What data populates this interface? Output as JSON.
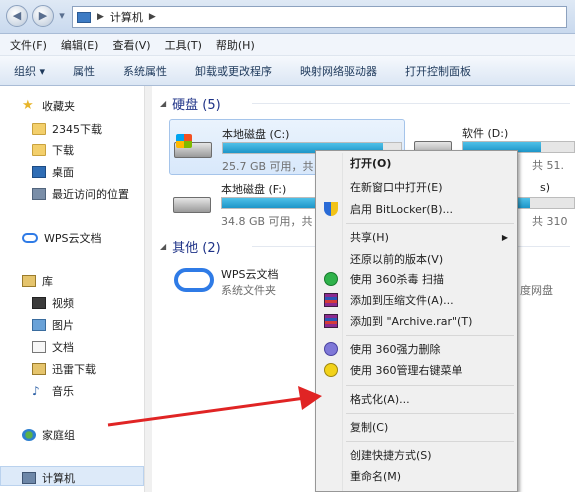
{
  "address": {
    "segments": [
      "计算机"
    ]
  },
  "menubar": [
    "文件(F)",
    "编辑(E)",
    "查看(V)",
    "工具(T)",
    "帮助(H)"
  ],
  "toolbar": [
    "组织 ▾",
    "属性",
    "系统属性",
    "卸载或更改程序",
    "映射网络驱动器",
    "打开控制面板"
  ],
  "nav": {
    "favorites": "收藏夹",
    "fav_items": [
      "2345下载",
      "下载",
      "桌面",
      "最近访问的位置"
    ],
    "wps": "WPS云文档",
    "library": "库",
    "lib_items": [
      "视频",
      "图片",
      "文档",
      "迅雷下载",
      "音乐"
    ],
    "homegroup": "家庭组",
    "computer": "计算机"
  },
  "content": {
    "hdd_group": "硬盘 (5)",
    "other_group": "其他 (2)",
    "drives": [
      {
        "name": "本地磁盘 (C:)",
        "info": "25.7 GB 可用，共",
        "used": 0.9
      },
      {
        "name": "本地磁盘 (F:)",
        "info": "34.8 GB 可用，共",
        "used": 0.8
      },
      {
        "name": "软件 (D:)",
        "info": "共 51.",
        "used": 0.7
      },
      {
        "name": "s)",
        "info": "共 310",
        "used": 0.6
      }
    ],
    "other": [
      {
        "name": "WPS云文档",
        "info": "系统文件夹"
      },
      {
        "name": "",
        "info": "度网盘"
      }
    ]
  },
  "context_menu": {
    "items": [
      {
        "label": "打开(O)",
        "bold": true,
        "icon": ""
      },
      {
        "label": "在新窗口中打开(E)",
        "icon": ""
      },
      {
        "label": "启用 BitLocker(B)...",
        "icon": "shield-icon"
      },
      {
        "label": "共享(H)",
        "icon": "",
        "submenu": true
      },
      {
        "label": "还原以前的版本(V)",
        "icon": ""
      },
      {
        "label": "使用 360杀毒 扫描",
        "icon": "360-antivirus-icon"
      },
      {
        "label": "添加到压缩文件(A)...",
        "icon": "winrar-icon"
      },
      {
        "label": "添加到 \"Archive.rar\"(T)",
        "icon": "winrar-icon"
      },
      {
        "label": "使用 360强力删除",
        "icon": "360-delete-icon"
      },
      {
        "label": "使用 360管理右键菜单",
        "icon": "360-manager-icon"
      },
      {
        "label": "格式化(A)...",
        "icon": ""
      },
      {
        "label": "复制(C)",
        "icon": ""
      },
      {
        "label": "创建快捷方式(S)",
        "icon": ""
      },
      {
        "label": "重命名(M)",
        "icon": ""
      }
    ]
  },
  "colors": {
    "accent": "#1e3287",
    "arrow": "#e02424",
    "bar": "#26a0da"
  }
}
